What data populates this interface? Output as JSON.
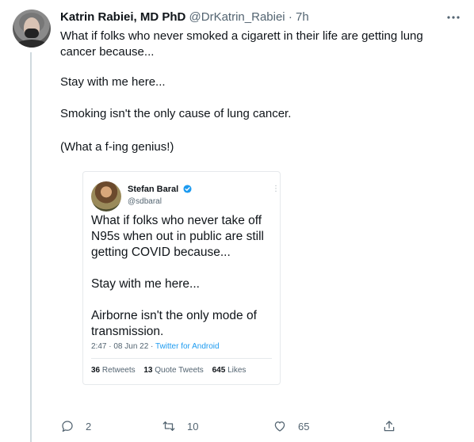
{
  "tweet": {
    "author_name": "Katrin Rabiei, MD PhD",
    "author_handle": "@DrKatrin_Rabiei",
    "separator": "·",
    "time": "7h",
    "paragraphs": [
      "What if folks who never smoked a cigarett in their life are getting lung cancer because...",
      "Stay with me here...",
      "Smoking isn't the only cause of lung cancer.",
      "(What a f-ing genius!)"
    ]
  },
  "embedded": {
    "author_name": "Stefan Baral",
    "author_handle": "@sdbaral",
    "paragraphs": [
      "What if folks who never take off N95s when out in public are still getting COVID because...",
      "Stay with me here...",
      "Airborne isn't the only mode of transmission."
    ],
    "timestamp": "2:47 · 08 Jun 22 · ",
    "source": "Twitter for Android",
    "retweets_count": "36",
    "retweets_label": "Retweets",
    "quotes_count": "13",
    "quotes_label": "Quote Tweets",
    "likes_count": "645",
    "likes_label": "Likes"
  },
  "actions": {
    "replies": "2",
    "retweets": "10",
    "likes": "65"
  },
  "colors": {
    "text": "#0f1419",
    "secondary": "#536471",
    "link": "#1d9bf0",
    "thread_line": "#cfd9de"
  }
}
